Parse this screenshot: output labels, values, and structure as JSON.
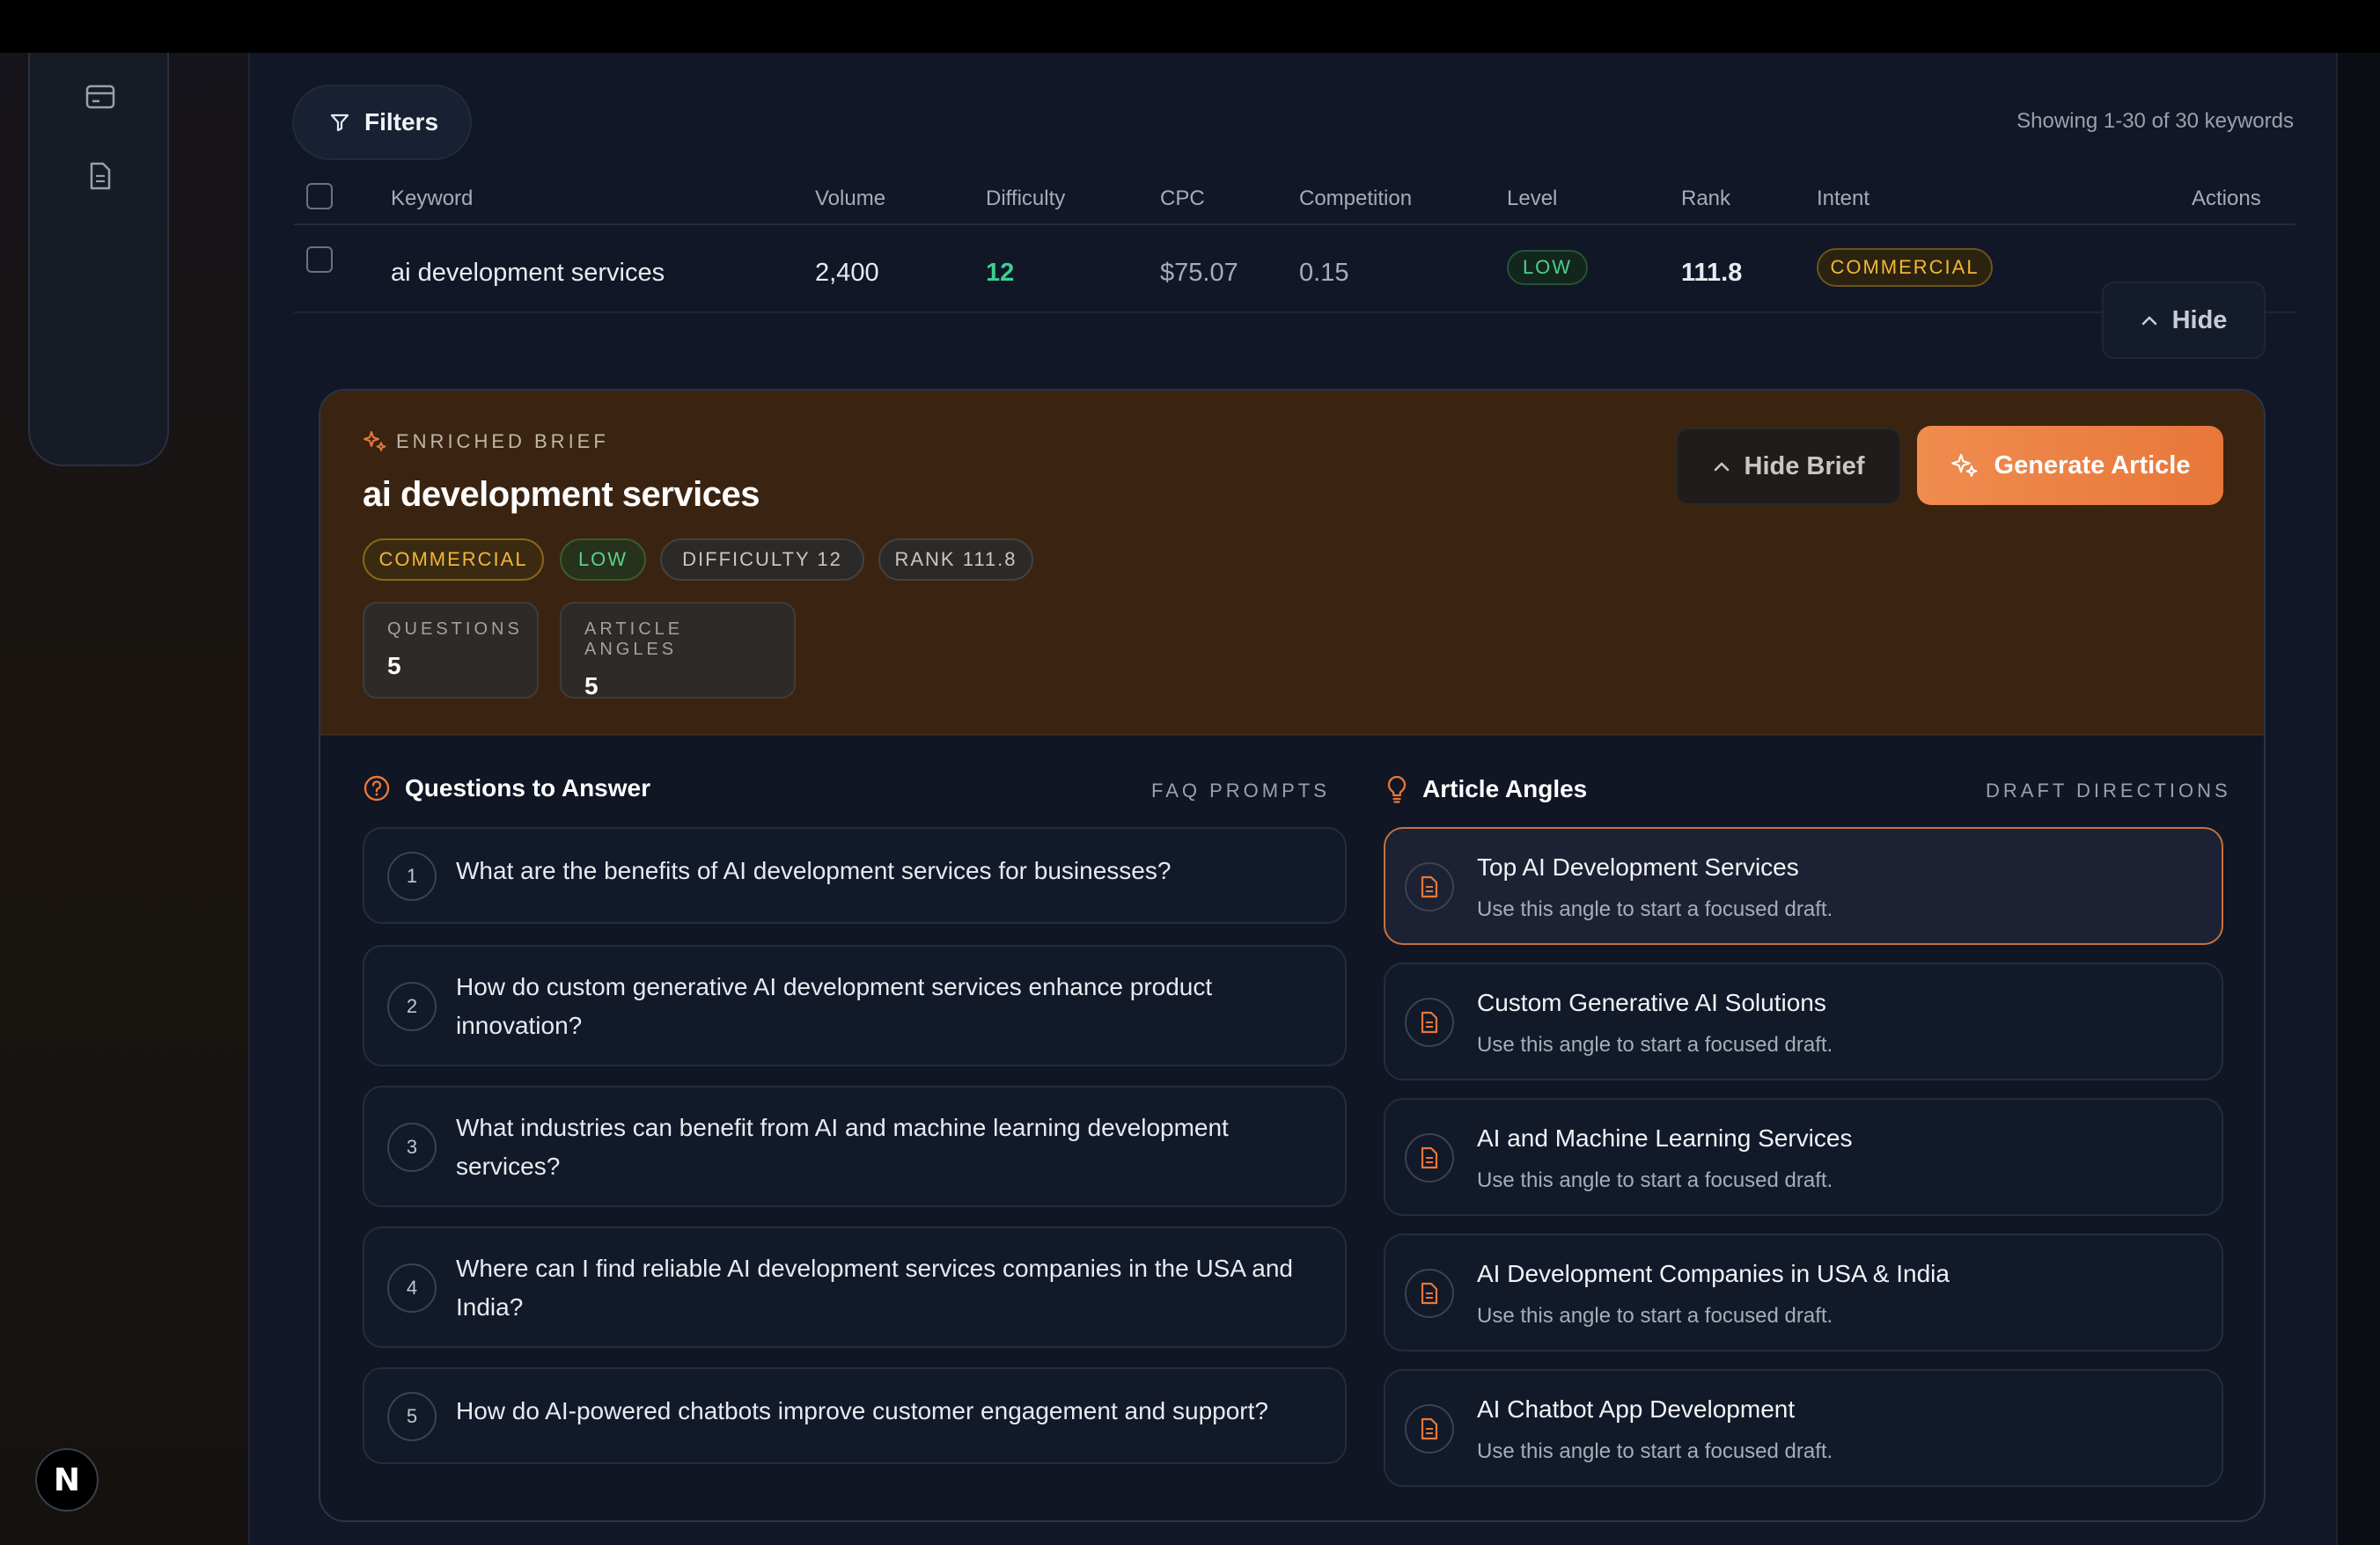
{
  "filters": {
    "label": "Filters"
  },
  "showing": "Showing 1-30 of 30 keywords",
  "table": {
    "headers": [
      "Keyword",
      "Volume",
      "Difficulty",
      "CPC",
      "Competition",
      "Level",
      "Rank",
      "Intent",
      "Actions"
    ],
    "row": {
      "keyword": "ai development services",
      "volume": "2,400",
      "difficulty": "12",
      "cpc": "$75.07",
      "competition": "0.15",
      "level": "LOW",
      "rank": "111.8",
      "intent": "COMMERCIAL",
      "action_label": "Hide"
    }
  },
  "brief": {
    "eyebrow": "ENRICHED BRIEF",
    "title": "ai development services",
    "chips": [
      "COMMERCIAL",
      "LOW",
      "DIFFICULTY 12",
      "RANK 111.8"
    ],
    "stats": [
      {
        "label": "QUESTIONS",
        "value": "5"
      },
      {
        "label": "ARTICLE ANGLES",
        "value": "5"
      }
    ],
    "hide_brief_label": "Hide Brief",
    "generate_label": "Generate Article"
  },
  "questions": {
    "title": "Questions to Answer",
    "tag": "FAQ PROMPTS",
    "items": [
      {
        "num": "1",
        "text": "What are the benefits of AI development services for businesses?"
      },
      {
        "num": "2",
        "text": "How do custom generative AI development services enhance product innovation?"
      },
      {
        "num": "3",
        "text": "What industries can benefit from AI and machine learning development services?"
      },
      {
        "num": "4",
        "text": "Where can I find reliable AI development services companies in the USA and India?"
      },
      {
        "num": "5",
        "text": "How do AI-powered chatbots improve customer engagement and support?"
      }
    ]
  },
  "angles": {
    "title": "Article Angles",
    "tag": "DRAFT DIRECTIONS",
    "items": [
      {
        "title": "Top AI Development Services",
        "sub": "Use this angle to start a focused draft."
      },
      {
        "title": "Custom Generative AI Solutions",
        "sub": "Use this angle to start a focused draft."
      },
      {
        "title": "AI and Machine Learning Services",
        "sub": "Use this angle to start a focused draft."
      },
      {
        "title": "AI Development Companies in USA & India",
        "sub": "Use this angle to start a focused draft."
      },
      {
        "title": "AI Chatbot App Development",
        "sub": "Use this angle to start a focused draft."
      }
    ]
  },
  "badge": {
    "letter": "N"
  },
  "colors": {
    "accent": "#e8773a",
    "success": "#3ecf8e",
    "warning": "#f2b735"
  }
}
